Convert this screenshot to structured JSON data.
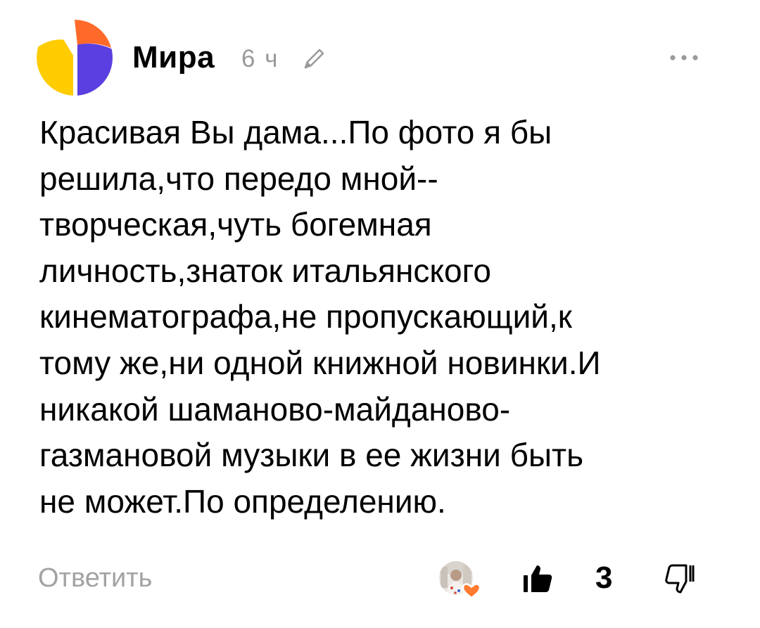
{
  "comment": {
    "author": {
      "name": "Мира",
      "avatar_icon": "yandex-zen-default-avatar"
    },
    "time": "6 ч",
    "edited_icon": "pencil-icon",
    "more_icon": "more-dots-icon",
    "text": "Красивая Вы дама...По фото я бы\nрешила,что передо мной--\nтворческая,чуть богемная\nличность,знаток итальянского\nкинематографа,не пропускающий,к\nтому же,ни одной книжной новинки.И\nникакой шаманово-майданово-\nгазмановой музыки в ее жизни быть\nне может.По определению.",
    "actions": {
      "reply_label": "Ответить",
      "like_icon": "thumbs-up-icon",
      "like_count": "3",
      "dislike_icon": "thumbs-down-icon",
      "liker_avatar_icon": "liker-avatar-heart"
    }
  },
  "colors": {
    "text": "#000000",
    "muted": "#9a9a9a",
    "avatar_yellow": "#ffcc00",
    "avatar_blue": "#5b3fe0",
    "avatar_orange": "#ff6a2b",
    "heart": "#ff7a2f"
  }
}
